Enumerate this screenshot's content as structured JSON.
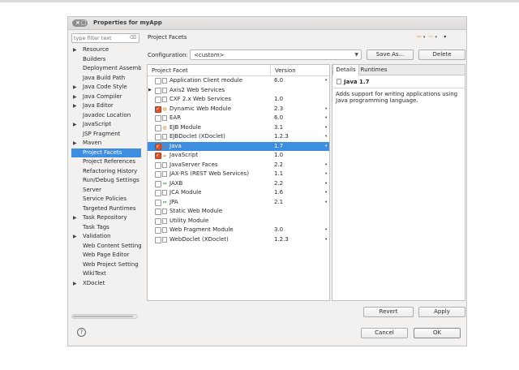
{
  "window": {
    "title": "Properties for myApp",
    "window_buttons": "× □"
  },
  "filter": {
    "placeholder": "type filter text",
    "clear_icon": "⌫"
  },
  "nav": {
    "items": [
      {
        "label": "Resource",
        "expandable": true
      },
      {
        "label": "Builders",
        "expandable": false
      },
      {
        "label": "Deployment Assemb",
        "expandable": false
      },
      {
        "label": "Java Build Path",
        "expandable": false
      },
      {
        "label": "Java Code Style",
        "expandable": true
      },
      {
        "label": "Java Compiler",
        "expandable": true
      },
      {
        "label": "Java Editor",
        "expandable": true
      },
      {
        "label": "Javadoc Location",
        "expandable": false
      },
      {
        "label": "JavaScript",
        "expandable": true
      },
      {
        "label": "JSP Fragment",
        "expandable": false
      },
      {
        "label": "Maven",
        "expandable": true
      },
      {
        "label": "Project Facets",
        "expandable": false,
        "selected": true
      },
      {
        "label": "Project References",
        "expandable": false
      },
      {
        "label": "Refactoring History",
        "expandable": false
      },
      {
        "label": "Run/Debug Settings",
        "expandable": false
      },
      {
        "label": "Server",
        "expandable": false
      },
      {
        "label": "Service Policies",
        "expandable": false
      },
      {
        "label": "Targeted Runtimes",
        "expandable": false
      },
      {
        "label": "Task Repository",
        "expandable": true
      },
      {
        "label": "Task Tags",
        "expandable": false
      },
      {
        "label": "Validation",
        "expandable": true
      },
      {
        "label": "Web Content Setting",
        "expandable": false
      },
      {
        "label": "Web Page Editor",
        "expandable": false
      },
      {
        "label": "Web Project Setting",
        "expandable": false
      },
      {
        "label": "WikiText",
        "expandable": false
      },
      {
        "label": "XDoclet",
        "expandable": true
      }
    ]
  },
  "page": {
    "title": "Project Facets"
  },
  "configuration": {
    "label": "Configuration:",
    "value": "<custom>",
    "save_as": "Save As...",
    "delete": "Delete"
  },
  "facets": {
    "col_facet": "Project Facet",
    "col_version": "Version",
    "rows": [
      {
        "name": "Application Client module",
        "version": "6.0",
        "checked": false,
        "icon": "doc",
        "dropdown": true,
        "expandable": false
      },
      {
        "name": "Axis2 Web Services",
        "version": "",
        "checked": false,
        "icon": "doc",
        "dropdown": false,
        "expandable": true
      },
      {
        "name": "CXF 2.x Web Services",
        "version": "1.0",
        "checked": false,
        "icon": "doc",
        "dropdown": false,
        "expandable": false
      },
      {
        "name": "Dynamic Web Module",
        "version": "2.3",
        "checked": true,
        "icon": "glob",
        "dropdown": true,
        "expandable": false
      },
      {
        "name": "EAR",
        "version": "6.0",
        "checked": false,
        "icon": "doc",
        "dropdown": true,
        "expandable": false
      },
      {
        "name": "EJB Module",
        "version": "3.1",
        "checked": false,
        "icon": "glob",
        "dropdown": true,
        "expandable": false
      },
      {
        "name": "EJBDoclet (XDoclet)",
        "version": "1.2.3",
        "checked": false,
        "icon": "doc",
        "dropdown": true,
        "expandable": false
      },
      {
        "name": "Java",
        "version": "1.7",
        "checked": true,
        "icon": "java",
        "dropdown": true,
        "expandable": false,
        "selected": true
      },
      {
        "name": "JavaScript",
        "version": "1.0",
        "checked": true,
        "icon": "java",
        "dropdown": false,
        "expandable": false
      },
      {
        "name": "JavaServer Faces",
        "version": "2.2",
        "checked": false,
        "icon": "doc",
        "dropdown": true,
        "expandable": false
      },
      {
        "name": "JAX-RS (REST Web Services)",
        "version": "1.1",
        "checked": false,
        "icon": "doc",
        "dropdown": true,
        "expandable": false
      },
      {
        "name": "JAXB",
        "version": "2.2",
        "checked": false,
        "icon": "arr",
        "dropdown": true,
        "expandable": false
      },
      {
        "name": "JCA Module",
        "version": "1.6",
        "checked": false,
        "icon": "doc",
        "dropdown": true,
        "expandable": false
      },
      {
        "name": "JPA",
        "version": "2.1",
        "checked": false,
        "icon": "arr",
        "dropdown": true,
        "expandable": false
      },
      {
        "name": "Static Web Module",
        "version": "",
        "checked": false,
        "icon": "doc",
        "dropdown": false,
        "expandable": false
      },
      {
        "name": "Utility Module",
        "version": "",
        "checked": false,
        "icon": "doc",
        "dropdown": false,
        "expandable": false
      },
      {
        "name": "Web Fragment Module",
        "version": "3.0",
        "checked": false,
        "icon": "doc",
        "dropdown": true,
        "expandable": false
      },
      {
        "name": "WebDoclet (XDoclet)",
        "version": "1.2.3",
        "checked": false,
        "icon": "doc",
        "dropdown": true,
        "expandable": false
      }
    ]
  },
  "details": {
    "tab_details": "Details",
    "tab_runtimes": "Runtimes",
    "heading": "Java 1.7",
    "text": "Adds support for writing applications using Java programming language."
  },
  "buttons": {
    "revert": "Revert",
    "apply": "Apply",
    "cancel": "Cancel",
    "ok": "OK",
    "help": "?"
  },
  "toolbar": {
    "back": "⇦",
    "forward": "⇨",
    "menu": "▾"
  },
  "colors": {
    "selection": "#3d8ee0",
    "checked": "#d9542a"
  }
}
